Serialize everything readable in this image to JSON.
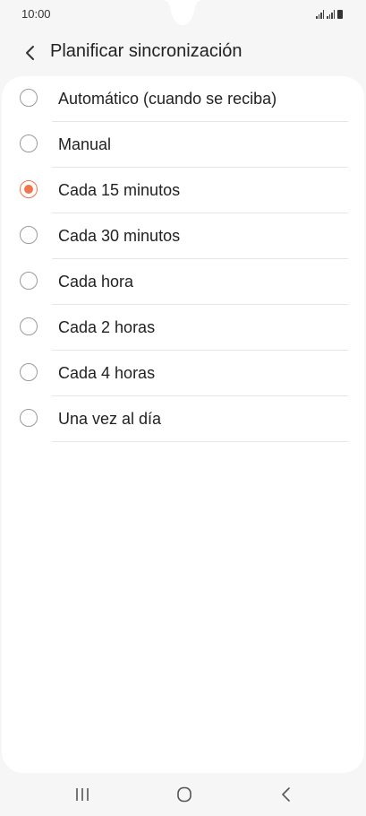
{
  "status_bar": {
    "time": "10:00"
  },
  "header": {
    "title": "Planificar sincronización",
    "back_icon": "back-chevron-icon"
  },
  "options": [
    {
      "label": "Automático (cuando se reciba)",
      "selected": false
    },
    {
      "label": "Manual",
      "selected": false
    },
    {
      "label": "Cada 15 minutos",
      "selected": true
    },
    {
      "label": "Cada 30 minutos",
      "selected": false
    },
    {
      "label": "Cada hora",
      "selected": false
    },
    {
      "label": "Cada 2 horas",
      "selected": false
    },
    {
      "label": "Cada 4 horas",
      "selected": false
    },
    {
      "label": "Una vez al día",
      "selected": false
    }
  ],
  "nav_bar": {
    "recents_icon": "recent-apps-icon",
    "home_icon": "home-icon",
    "back_icon": "back-icon"
  },
  "colors": {
    "accent": "#f0754a",
    "background": "#f6f6f6",
    "card": "#ffffff"
  }
}
